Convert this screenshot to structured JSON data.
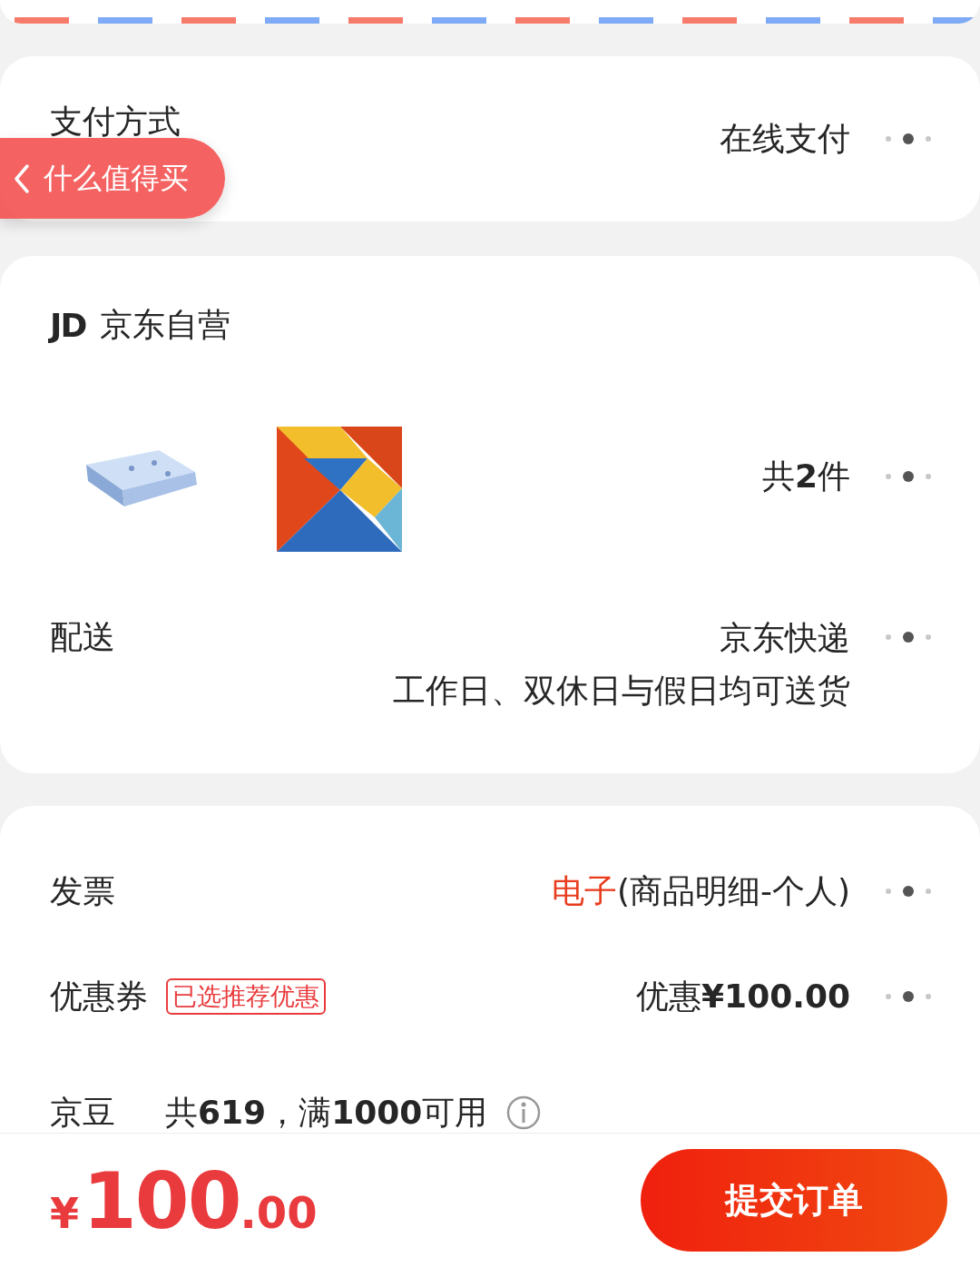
{
  "payment": {
    "label": "支付方式",
    "value": "在线支付"
  },
  "overlay": {
    "back_label": "什么值得买"
  },
  "shop": {
    "badge": "JD",
    "name": "京东自营"
  },
  "products": {
    "count": "共**2**件"
  },
  "delivery": {
    "label": "配送",
    "value": "京东快递",
    "note": "工作日、双休日与假日均可送货"
  },
  "invoice": {
    "label": "发票",
    "type": "电子",
    "detail": "(商品明细-个人)"
  },
  "coupon": {
    "label": "优惠券",
    "tag": "已选推荐优惠",
    "value": "优惠**¥100.00**"
  },
  "beans": {
    "label": "京豆",
    "value": "共**619**，满**1000**可用"
  },
  "footer": {
    "currency": "¥",
    "amount": "100",
    "decimals": ".00",
    "submit": "提交订单"
  }
}
